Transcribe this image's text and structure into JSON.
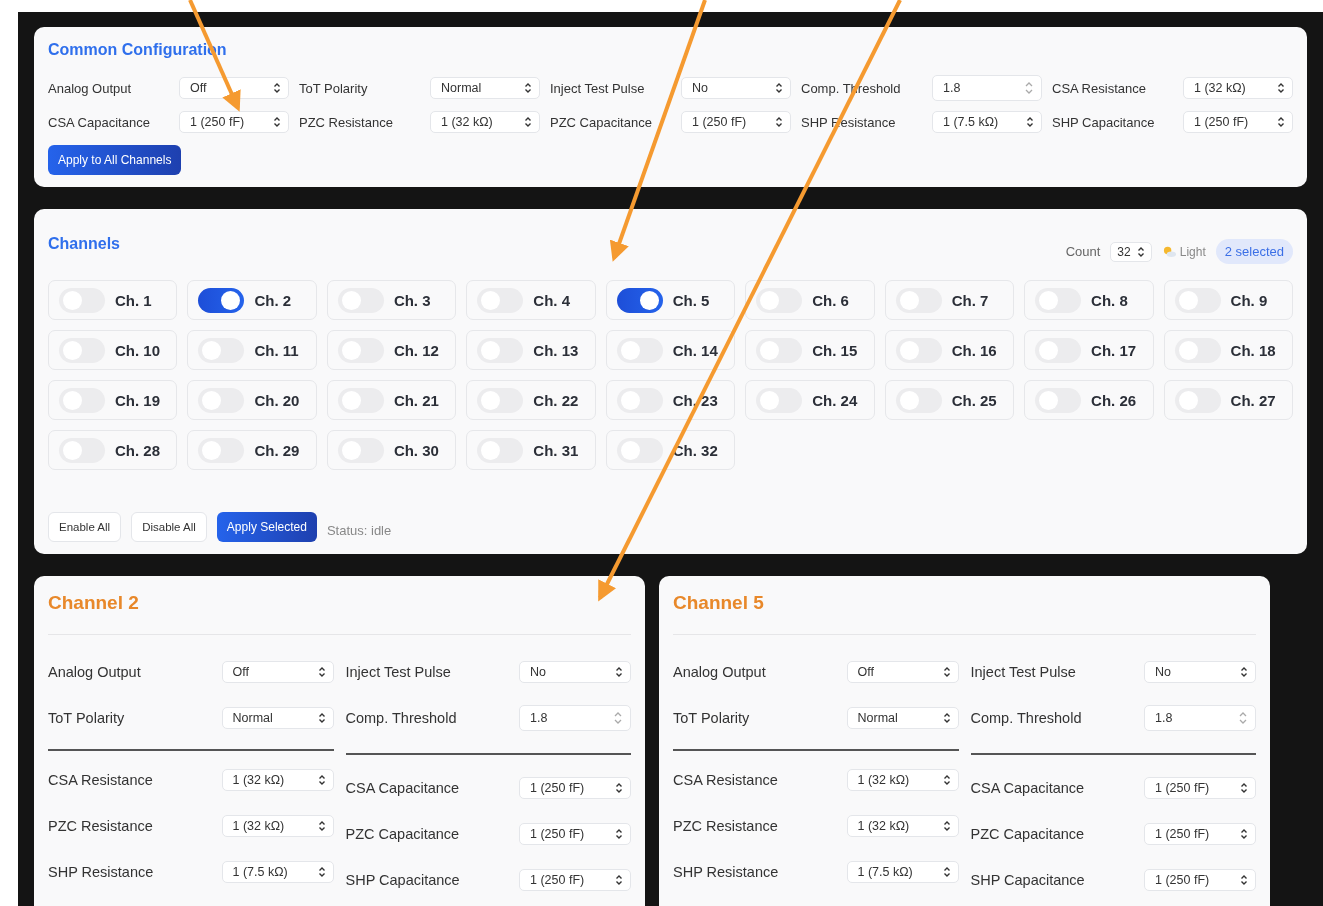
{
  "common": {
    "title": "Common Configuration",
    "fields": [
      {
        "label": "Analog Output",
        "value": "Off",
        "kind": "select"
      },
      {
        "label": "ToT Polarity",
        "value": "Normal",
        "kind": "select"
      },
      {
        "label": "Inject Test Pulse",
        "value": "No",
        "kind": "select"
      },
      {
        "label": "Comp. Threshold",
        "value": "1.8",
        "kind": "number"
      },
      {
        "label": "CSA Resistance",
        "value": "1 (32 kΩ)",
        "kind": "select"
      },
      {
        "label": "CSA Capacitance",
        "value": "1 (250 fF)",
        "kind": "select"
      },
      {
        "label": "PZC Resistance",
        "value": "1 (32 kΩ)",
        "kind": "select"
      },
      {
        "label": "PZC Capacitance",
        "value": "1 (250 fF)",
        "kind": "select"
      },
      {
        "label": "SHP Resistance",
        "value": "1 (7.5 kΩ)",
        "kind": "select"
      },
      {
        "label": "SHP Capacitance",
        "value": "1 (250 fF)",
        "kind": "select"
      }
    ],
    "button": "Apply to All Channels"
  },
  "channels": {
    "title": "Channels",
    "count_label": "Count",
    "count": "32",
    "theme": "Light",
    "badge": "2 selected",
    "items": [
      {
        "label": "Ch. 1",
        "on": false
      },
      {
        "label": "Ch. 2",
        "on": true
      },
      {
        "label": "Ch. 3",
        "on": false
      },
      {
        "label": "Ch. 4",
        "on": false
      },
      {
        "label": "Ch. 5",
        "on": true
      },
      {
        "label": "Ch. 6",
        "on": false
      },
      {
        "label": "Ch. 7",
        "on": false
      },
      {
        "label": "Ch. 8",
        "on": false
      },
      {
        "label": "Ch. 9",
        "on": false
      },
      {
        "label": "Ch. 10",
        "on": false
      },
      {
        "label": "Ch. 11",
        "on": false
      },
      {
        "label": "Ch. 12",
        "on": false
      },
      {
        "label": "Ch. 13",
        "on": false
      },
      {
        "label": "Ch. 14",
        "on": false
      },
      {
        "label": "Ch. 15",
        "on": false
      },
      {
        "label": "Ch. 16",
        "on": false
      },
      {
        "label": "Ch. 17",
        "on": false
      },
      {
        "label": "Ch. 18",
        "on": false
      },
      {
        "label": "Ch. 19",
        "on": false
      },
      {
        "label": "Ch. 20",
        "on": false
      },
      {
        "label": "Ch. 21",
        "on": false
      },
      {
        "label": "Ch. 22",
        "on": false
      },
      {
        "label": "Ch. 23",
        "on": false
      },
      {
        "label": "Ch. 24",
        "on": false
      },
      {
        "label": "Ch. 25",
        "on": false
      },
      {
        "label": "Ch. 26",
        "on": false
      },
      {
        "label": "Ch. 27",
        "on": false
      },
      {
        "label": "Ch. 28",
        "on": false
      },
      {
        "label": "Ch. 29",
        "on": false
      },
      {
        "label": "Ch. 30",
        "on": false
      },
      {
        "label": "Ch. 31",
        "on": false
      },
      {
        "label": "Ch. 32",
        "on": false
      }
    ],
    "buttons": [
      {
        "label": "Enable All",
        "kind": "plain"
      },
      {
        "label": "Disable All",
        "kind": "plain"
      },
      {
        "label": "Apply Selected",
        "kind": "primary"
      }
    ],
    "status": "Status: idle"
  },
  "details": [
    {
      "title": "Channel 2",
      "top_left": [
        {
          "label": "Analog Output",
          "value": "Off",
          "kind": "select"
        },
        {
          "label": "ToT Polarity",
          "value": "Normal",
          "kind": "select"
        }
      ],
      "top_right": [
        {
          "label": "Inject Test Pulse",
          "value": "No",
          "kind": "select"
        },
        {
          "label": "Comp. Threshold",
          "value": "1.8",
          "kind": "number"
        }
      ],
      "bottom_left": [
        {
          "label": "CSA Resistance",
          "value": "1 (32 kΩ)",
          "kind": "select"
        },
        {
          "label": "PZC Resistance",
          "value": "1 (32 kΩ)",
          "kind": "select"
        },
        {
          "label": "SHP Resistance",
          "value": "1 (7.5 kΩ)",
          "kind": "select"
        }
      ],
      "bottom_right": [
        {
          "label": "CSA Capacitance",
          "value": "1 (250 fF)",
          "kind": "select"
        },
        {
          "label": "PZC Capacitance",
          "value": "1 (250 fF)",
          "kind": "select"
        },
        {
          "label": "SHP Capacitance",
          "value": "1 (250 fF)",
          "kind": "select"
        }
      ]
    },
    {
      "title": "Channel 5",
      "top_left": [
        {
          "label": "Analog Output",
          "value": "Off",
          "kind": "select"
        },
        {
          "label": "ToT Polarity",
          "value": "Normal",
          "kind": "select"
        }
      ],
      "top_right": [
        {
          "label": "Inject Test Pulse",
          "value": "No",
          "kind": "select"
        },
        {
          "label": "Comp. Threshold",
          "value": "1.8",
          "kind": "number"
        }
      ],
      "bottom_left": [
        {
          "label": "CSA Resistance",
          "value": "1 (32 kΩ)",
          "kind": "select"
        },
        {
          "label": "PZC Resistance",
          "value": "1 (32 kΩ)",
          "kind": "select"
        },
        {
          "label": "SHP Resistance",
          "value": "1 (7.5 kΩ)",
          "kind": "select"
        }
      ],
      "bottom_right": [
        {
          "label": "CSA Capacitance",
          "value": "1 (250 fF)",
          "kind": "select"
        },
        {
          "label": "PZC Capacitance",
          "value": "1 (250 fF)",
          "kind": "select"
        },
        {
          "label": "SHP Capacitance",
          "value": "1 (250 fF)",
          "kind": "select"
        }
      ]
    }
  ]
}
